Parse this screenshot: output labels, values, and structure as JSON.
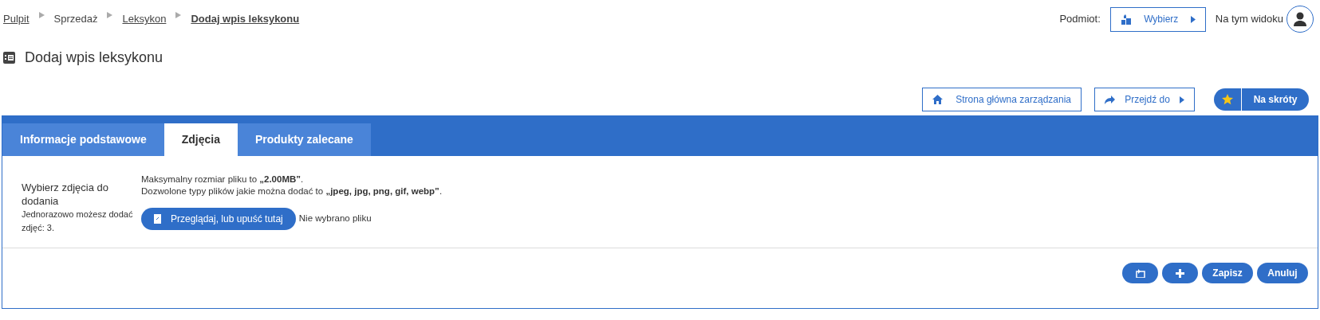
{
  "breadcrumb": [
    {
      "label": "Pulpit",
      "kind": "link"
    },
    {
      "label": "Sprzedaż",
      "kind": "plain"
    },
    {
      "label": "Leksykon",
      "kind": "link"
    },
    {
      "label": "Dodaj wpis leksykonu",
      "kind": "current"
    }
  ],
  "header": {
    "entity_label": "Podmiot:",
    "entity_button": "Wybierz",
    "view_label": "Na tym widoku"
  },
  "page_title": "Dodaj wpis leksykonu",
  "actions": {
    "home": "Strona główna zarządzania",
    "goto": "Przejdź do",
    "shortcuts": "Na skróty"
  },
  "tabs": [
    {
      "label": "Informacje podstawowe",
      "selected": false
    },
    {
      "label": "Zdjęcia",
      "selected": true
    },
    {
      "label": "Produkty zalecane",
      "selected": false
    }
  ],
  "upload": {
    "label": "Wybierz zdjęcia do dodania",
    "hint": "Jednorazowo możesz dodać zdjęć: 3.",
    "max_size": "Maksymalny rozmiar pliku to **„2.00MB”**.",
    "types": "Dozwolone typy plików jakie można dodać to **„jpeg, jpg, png, gif, webp”**.",
    "browse_button": "Przeglądaj, lub upuść tutaj",
    "file_status": "Nie wybrano pliku"
  },
  "footer_buttons": [
    {
      "kind": "back"
    },
    {
      "kind": "add"
    },
    {
      "kind": "text",
      "label": "Zapisz"
    },
    {
      "kind": "text",
      "label": "Anuluj"
    }
  ]
}
